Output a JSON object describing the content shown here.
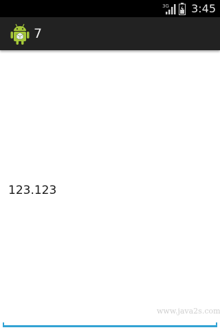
{
  "status_bar": {
    "network_type": "3G",
    "time": "3:45",
    "icons": [
      "signal-icon",
      "battery-icon"
    ]
  },
  "action_bar": {
    "icon": "android-icon",
    "title": "7"
  },
  "content": {
    "text": "123.123"
  },
  "watermark": "www.java2s.com",
  "colors": {
    "status_bar_bg": "#000000",
    "action_bar_bg": "#222222",
    "accent": "#33a3d4",
    "android_green": "#a4c639"
  }
}
